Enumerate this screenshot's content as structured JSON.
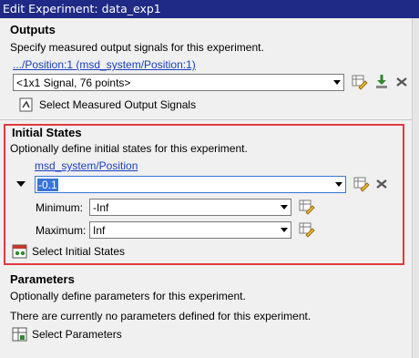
{
  "window": {
    "title": "Edit Experiment: data_exp1"
  },
  "outputs": {
    "title": "Outputs",
    "description": "Specify measured output signals for this experiment.",
    "signal_link": ".../Position:1 (msd_system/Position:1)",
    "combo_value": "<1x1 Signal, 76 points>",
    "select_button": "Select Measured Output Signals"
  },
  "initial_states": {
    "title": "Initial States",
    "description": "Optionally define initial states for this experiment.",
    "state_link": "msd_system/Position",
    "value": "-0.1",
    "minimum_label": "Minimum:",
    "minimum_value": "-Inf",
    "maximum_label": "Maximum:",
    "maximum_value": "Inf",
    "select_button": "Select Initial States"
  },
  "parameters": {
    "title": "Parameters",
    "description": "Optionally define parameters for this experiment.",
    "empty_message": "There are currently no parameters defined for this experiment.",
    "select_button": "Select Parameters"
  },
  "colors": {
    "highlight_box": "#e33a3a",
    "link": "#1a40c0",
    "titlebar": "#1f2a86"
  },
  "icons": [
    "edit-icon",
    "import-icon",
    "delete-icon",
    "select-signals-icon",
    "select-states-icon",
    "select-parameters-icon",
    "expand-arrow-icon"
  ]
}
